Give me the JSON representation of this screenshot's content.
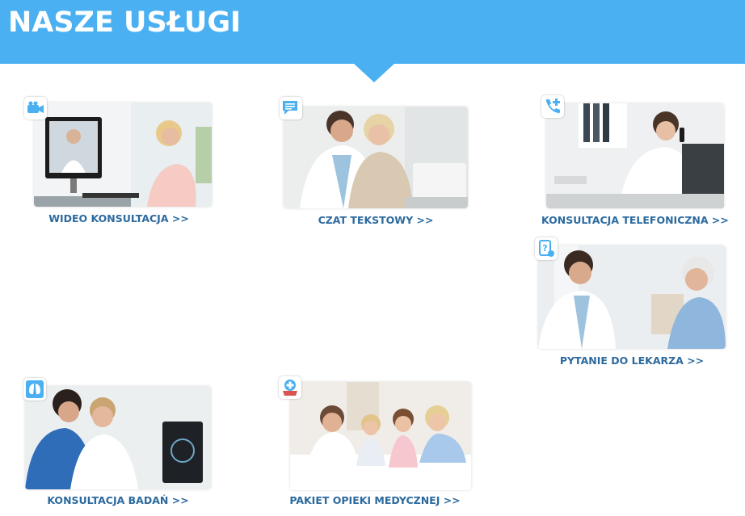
{
  "header": {
    "title": "NASZE USŁUGI",
    "background_color": "#4ab0f1"
  },
  "services": [
    {
      "label": "WIDEO KONSULTACJA >>",
      "icon": "video-camera-icon"
    },
    {
      "label": "CZAT TEKSTOWY >>",
      "icon": "chat-bubble-icon"
    },
    {
      "label": "KONSULTACJA TELEFONICZNA >>",
      "icon": "phone-plus-icon"
    },
    {
      "label": "PYTANIE DO LEKARZA >>",
      "icon": "question-tablet-icon"
    },
    {
      "label": "KONSULTACJA BADAŃ >>",
      "icon": "lungs-icon"
    },
    {
      "label": "PAKIET OPIEKI MEDYCZNEJ >>",
      "icon": "medical-package-icon"
    }
  ],
  "colors": {
    "accent": "#4ab0f1",
    "label_text": "#2c6a9e"
  }
}
